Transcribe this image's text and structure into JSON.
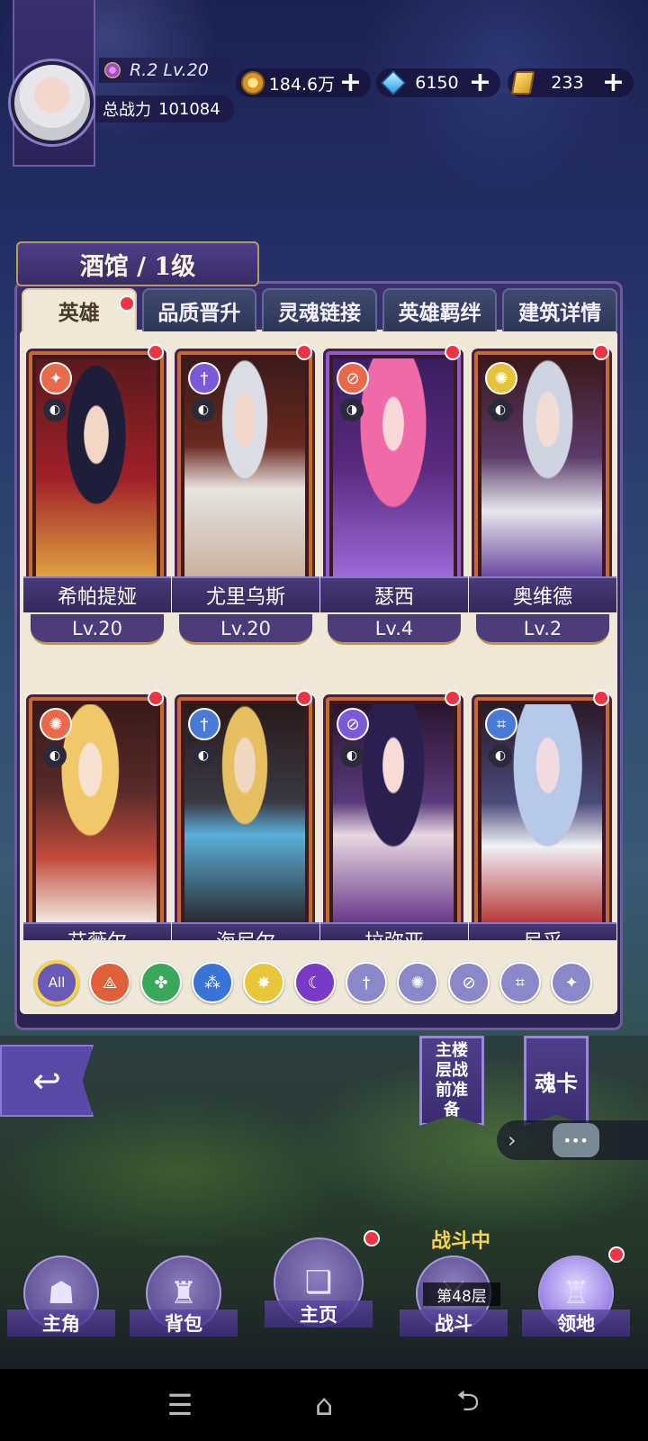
{
  "player": {
    "rank_level": "R.2 Lv.20",
    "power_label": "总战力",
    "power_value": "101084"
  },
  "resources": [
    {
      "icon": "gold-coin-icon",
      "value": "184.6万"
    },
    {
      "icon": "blue-crystal-icon",
      "value": "6150"
    },
    {
      "icon": "gold-bar-icon",
      "value": "233"
    }
  ],
  "panel": {
    "title": "酒馆 / 1级",
    "tabs": [
      "英雄",
      "品质晋升",
      "灵魂链接",
      "英雄羁绊",
      "建筑详情"
    ]
  },
  "heroes": [
    {
      "name": "希帕提娅",
      "level": "Lv.20",
      "class_icon": "wing-icon",
      "class_color": "#e86a4a"
    },
    {
      "name": "尤里乌斯",
      "level": "Lv.20",
      "class_icon": "dagger-icon",
      "class_color": "#7a5ad8"
    },
    {
      "name": "瑟西",
      "level": "Lv.4",
      "class_icon": "magnifier-icon",
      "class_color": "#e86a4a"
    },
    {
      "name": "奥维德",
      "level": "Lv.2",
      "class_icon": "shuriken-icon",
      "class_color": "#e6c23a"
    },
    {
      "name": "艾薇尔",
      "level": "",
      "class_icon": "shuriken-icon",
      "class_color": "#e86a4a"
    },
    {
      "name": "海尼尔",
      "level": "",
      "class_icon": "dagger-icon",
      "class_color": "#4a7ad8"
    },
    {
      "name": "拉弥亚",
      "level": "",
      "class_icon": "magnifier-icon",
      "class_color": "#7a5ad8"
    },
    {
      "name": "尼采",
      "level": "",
      "class_icon": "scroll-icon",
      "class_color": "#4a7ad8"
    }
  ],
  "filters": {
    "all_label": "All",
    "items": [
      {
        "icon": "triquetra-icon",
        "color": "#e0603a"
      },
      {
        "icon": "clover-icon",
        "color": "#3aa85a"
      },
      {
        "icon": "water-trinity-icon",
        "color": "#3a74d8"
      },
      {
        "icon": "sun-star-icon",
        "color": "#e8c63a"
      },
      {
        "icon": "moon-icon",
        "color": "#7a3ac8"
      },
      {
        "icon": "dagger-icon",
        "color": "#8a88c8"
      },
      {
        "icon": "shuriken-icon",
        "color": "#8a88c8"
      },
      {
        "icon": "magnifier-icon",
        "color": "#8a88c8"
      },
      {
        "icon": "scroll-icon",
        "color": "#8a88c8"
      },
      {
        "icon": "wing-icon",
        "color": "#8a88c8"
      }
    ]
  },
  "side": {
    "floor_prep": "主楼层战前准备",
    "soul_card": "魂卡"
  },
  "battle": {
    "status": "战斗中",
    "floor": "第48层"
  },
  "nav": [
    "主角",
    "背包",
    "主页",
    "战斗",
    "领地"
  ]
}
